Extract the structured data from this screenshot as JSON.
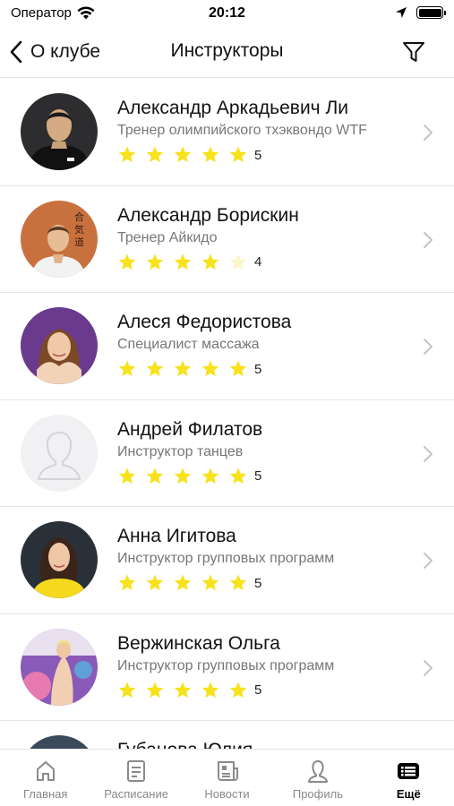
{
  "status_bar": {
    "carrier": "Оператор",
    "time": "20:12"
  },
  "nav": {
    "back_label": "О клубе",
    "title": "Инструкторы"
  },
  "colors": {
    "star_filled": "#f7e21b",
    "star_empty": "#fbf5c8",
    "chevron": "#c4c4c8",
    "tab_inactive": "#8a8a8a",
    "tab_active": "#000000"
  },
  "instructors": [
    {
      "name": "Александр Аркадьевич Ли",
      "role": "Тренер олимпийского тхэквондо WTF",
      "rating": 5,
      "avatar": "photo-man-black-shirt"
    },
    {
      "name": "Александр Борискин",
      "role": "Тренер Айкидо",
      "rating": 4,
      "avatar": "photo-man-kimono"
    },
    {
      "name": "Алеся Федористова",
      "role": "Специалист массажа",
      "rating": 5,
      "avatar": "photo-woman-purple"
    },
    {
      "name": "Андрей Филатов",
      "role": "Инструктор танцев",
      "rating": 5,
      "avatar": "placeholder-person-icon"
    },
    {
      "name": "Анна Игитова",
      "role": "Инструктор групповых программ",
      "rating": 5,
      "avatar": "photo-woman-yellow"
    },
    {
      "name": "Вержинская Ольга",
      "role": "Инструктор групповых программ",
      "rating": 5,
      "avatar": "photo-woman-fitball"
    },
    {
      "name": "Губанова Юлия",
      "role": "",
      "rating": null,
      "avatar": "photo-woman-partial"
    }
  ],
  "tabs": [
    {
      "label": "Главная",
      "icon": "home-icon",
      "active": false
    },
    {
      "label": "Расписание",
      "icon": "schedule-icon",
      "active": false
    },
    {
      "label": "Новости",
      "icon": "news-icon",
      "active": false
    },
    {
      "label": "Профиль",
      "icon": "profile-icon",
      "active": false
    },
    {
      "label": "Ещё",
      "icon": "more-list-icon",
      "active": true
    }
  ]
}
